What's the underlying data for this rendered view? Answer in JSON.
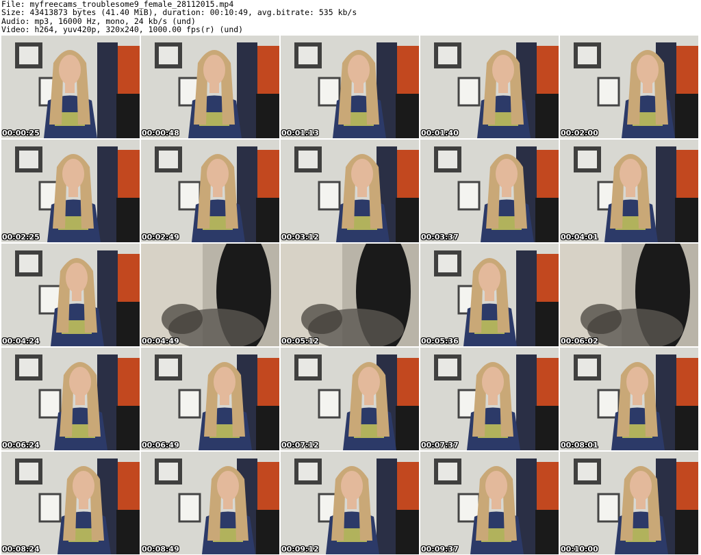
{
  "header": {
    "file_line": "File: myfreecams_troublesome9_female_28112015.mp4",
    "size_line": "Size: 43413873 bytes (41.40 MiB), duration: 00:10:49, avg.bitrate: 535 kb/s",
    "audio_line": "Audio: mp3, 16000 Hz, mono, 24 kb/s (und)",
    "video_line": "Video: h264, yuv420p, 320x240, 1000.00 fps(r) (und)"
  },
  "thumbnails": [
    {
      "time": "00:00:25",
      "scene": "person"
    },
    {
      "time": "00:00:48",
      "scene": "person"
    },
    {
      "time": "00:01:13",
      "scene": "person"
    },
    {
      "time": "00:01:40",
      "scene": "person"
    },
    {
      "time": "00:02:00",
      "scene": "person"
    },
    {
      "time": "00:02:25",
      "scene": "person"
    },
    {
      "time": "00:02:49",
      "scene": "person"
    },
    {
      "time": "00:03:12",
      "scene": "person"
    },
    {
      "time": "00:03:37",
      "scene": "person"
    },
    {
      "time": "00:04:01",
      "scene": "person"
    },
    {
      "time": "00:04:24",
      "scene": "person"
    },
    {
      "time": "00:04:49",
      "scene": "blurred-room"
    },
    {
      "time": "00:05:12",
      "scene": "blurred-room"
    },
    {
      "time": "00:05:36",
      "scene": "person"
    },
    {
      "time": "00:06:02",
      "scene": "blurred-room"
    },
    {
      "time": "00:06:24",
      "scene": "person"
    },
    {
      "time": "00:06:49",
      "scene": "person"
    },
    {
      "time": "00:07:12",
      "scene": "person"
    },
    {
      "time": "00:07:37",
      "scene": "person"
    },
    {
      "time": "00:08:01",
      "scene": "person"
    },
    {
      "time": "00:08:24",
      "scene": "person"
    },
    {
      "time": "00:08:49",
      "scene": "person"
    },
    {
      "time": "00:09:12",
      "scene": "person"
    },
    {
      "time": "00:09:37",
      "scene": "person"
    },
    {
      "time": "00:10:00",
      "scene": "person"
    }
  ],
  "colors": {
    "wall": "#d8d8d2",
    "curtain": "#2a2f45",
    "shirt": "#2c3a68",
    "shirt_print": "#c9c85a",
    "hair": "#c9a877",
    "skin": "#e3b99b",
    "poster": "#c2481f",
    "dark": "#1a1a1a"
  }
}
